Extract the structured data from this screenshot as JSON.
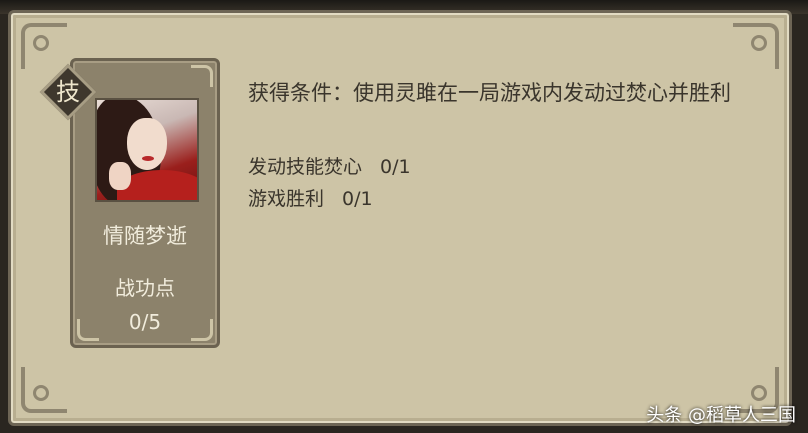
{
  "skill_badge": {
    "glyph": "技",
    "icon": "skill-badge-icon"
  },
  "hero": {
    "name": "情随梦逝",
    "merit_label": "战功点",
    "merit_value": "0/5"
  },
  "condition": {
    "text": "获得条件：使用灵雎在一局游戏内发动过焚心并胜利"
  },
  "progress": [
    {
      "label": "发动技能焚心",
      "count": "0/1"
    },
    {
      "label": "游戏胜利",
      "count": "0/1"
    }
  ],
  "watermark": "头条 @稻草人三国",
  "colors": {
    "panel": "#cdc4a6",
    "card": "#8c826b",
    "text_dark": "#3a352c",
    "text_light": "#f1ecdc"
  }
}
